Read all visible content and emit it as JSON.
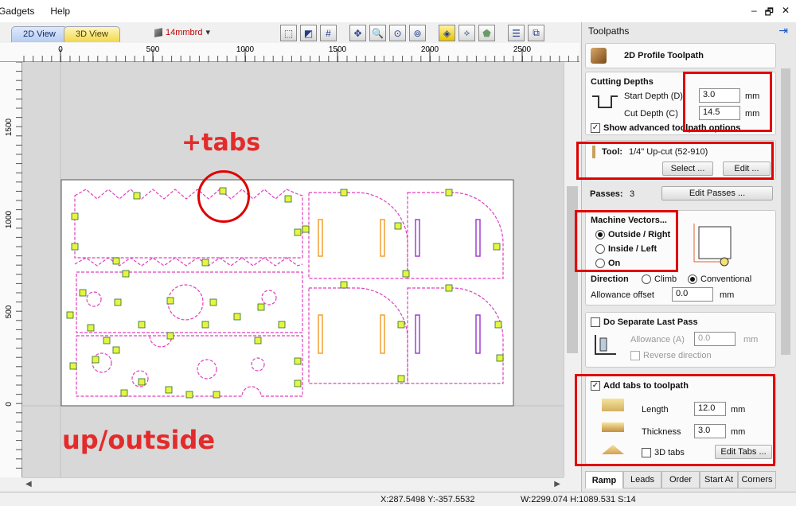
{
  "menu": {
    "items": [
      "Gadgets",
      "Help"
    ]
  },
  "window_controls": {
    "minimize": "–",
    "restore": "🗗",
    "close": "✕"
  },
  "view_tabs": {
    "tab_2d": "2D View",
    "tab_3d": "3D View"
  },
  "material": {
    "name": "14mmbrd",
    "caret": "▾"
  },
  "rulers": {
    "top": [
      "0",
      "500",
      "1000",
      "1500",
      "2000",
      "2500"
    ],
    "left": [
      "1500",
      "1000",
      "500",
      "0"
    ]
  },
  "annotations": {
    "tabs_note": "+tabs",
    "direction_note": "up/outside"
  },
  "status": {
    "coords": "X:287.5498 Y:-357.5532",
    "dims": "W:2299.074  H:1089.531  S:14"
  },
  "panel": {
    "title": "Toolpaths",
    "header": "2D Profile Toolpath",
    "cutting_depths": {
      "title": "Cutting Depths",
      "start_label": "Start Depth (D)",
      "start_value": "3.0",
      "cut_label": "Cut Depth (C)",
      "cut_value": "14.5",
      "unit": "mm",
      "show_advanced": "Show advanced toolpath options"
    },
    "tool": {
      "label": "Tool:",
      "name": "1/4\" Up-cut (52-910)",
      "select_btn": "Select ...",
      "edit_btn": "Edit ..."
    },
    "passes": {
      "label": "Passes:",
      "value": "3",
      "edit_btn": "Edit Passes ..."
    },
    "machine_vectors": {
      "title": "Machine Vectors...",
      "options": [
        "Outside / Right",
        "Inside / Left",
        "On"
      ],
      "selected": "Outside / Right",
      "direction_label": "Direction",
      "direction_options": [
        "Climb",
        "Conventional"
      ],
      "direction_selected": "Conventional",
      "allowance_label": "Allowance offset",
      "allowance_value": "0.0",
      "unit": "mm"
    },
    "separate_last_pass": {
      "title": "Do Separate Last Pass",
      "allowance_label": "Allowance (A)",
      "allowance_value": "0.0",
      "unit": "mm",
      "reverse_label": "Reverse direction"
    },
    "tabs": {
      "title": "Add tabs to toolpath",
      "length_label": "Length",
      "length_value": "12.0",
      "thickness_label": "Thickness",
      "thickness_value": "3.0",
      "unit": "mm",
      "tabs3d_label": "3D tabs",
      "edit_btn": "Edit Tabs ..."
    },
    "bottom_tabs": [
      "Ramp",
      "Leads",
      "Order",
      "Start At",
      "Corners"
    ],
    "active_bottom_tab": "Ramp"
  },
  "colors": {
    "accent_red": "#e00000",
    "toolpath_magenta": "#e040c0",
    "tab_marker": "#e6f542"
  }
}
